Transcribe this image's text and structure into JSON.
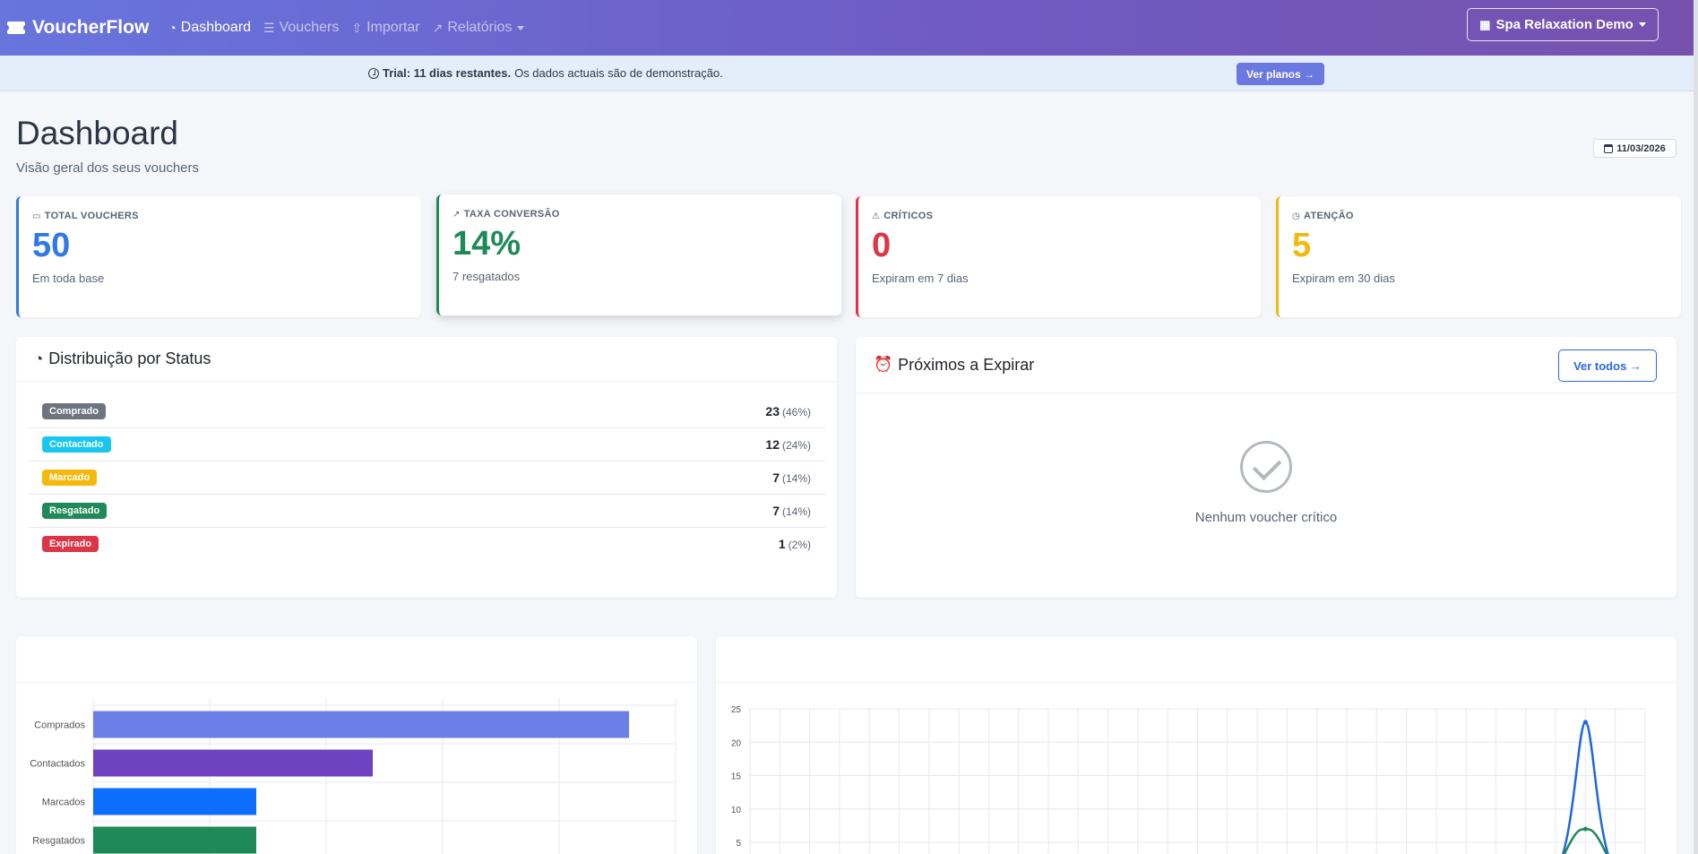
{
  "navbar": {
    "brand": "VoucherFlow",
    "items": [
      {
        "label": "Dashboard",
        "icon": "speedometer-icon",
        "active": true
      },
      {
        "label": "Vouchers",
        "icon": "list-icon",
        "active": false
      },
      {
        "label": "Importar",
        "icon": "upload-icon",
        "active": false
      },
      {
        "label": "Relatórios",
        "icon": "graph-icon",
        "active": false
      }
    ],
    "company": "Spa Relaxation Demo"
  },
  "trial": {
    "bold": "Trial: 11 dias restantes.",
    "text": "Os dados actuais são de demonstração.",
    "button": "Ver planos →"
  },
  "header": {
    "title": "Dashboard",
    "subtitle": "Visão geral dos seus vouchers",
    "date": "11/03/2026"
  },
  "stats": [
    {
      "label": "TOTAL VOUCHERS",
      "value": "50",
      "note": "Em toda base",
      "color": "#2f7ae5",
      "icon": "ticket-icon"
    },
    {
      "label": "TAXA CONVERSÃO",
      "value": "14%",
      "note": "7 resgatados",
      "color": "#1f8a57",
      "icon": "graph-up-icon"
    },
    {
      "label": "CRÍTICOS",
      "value": "0",
      "note": "Expiram em 7 dias",
      "color": "#dc3545",
      "icon": "warning-icon"
    },
    {
      "label": "ATENÇÃO",
      "value": "5",
      "note": "Expiram em 30 dias",
      "color": "#f0b912",
      "icon": "clock-icon"
    }
  ],
  "distribution": {
    "title": "Distribuição por Status",
    "rows": [
      {
        "label": "Comprado",
        "count": "23",
        "pct": "(46%)",
        "color": "#6c757d"
      },
      {
        "label": "Contactado",
        "count": "12",
        "pct": "(24%)",
        "color": "#18c6ee"
      },
      {
        "label": "Marcado",
        "count": "7",
        "pct": "(14%)",
        "color": "#f5b90d"
      },
      {
        "label": "Resgatado",
        "count": "7",
        "pct": "(14%)",
        "color": "#1f8a57"
      },
      {
        "label": "Expirado",
        "count": "1",
        "pct": "(2%)",
        "color": "#dc3545"
      }
    ]
  },
  "expiring": {
    "title": "Próximos a Expirar",
    "button": "Ver todos →",
    "empty": "Nenhum voucher crítico"
  },
  "chart_data": [
    {
      "type": "bar",
      "orientation": "horizontal",
      "categories": [
        "Comprados",
        "Contactados",
        "Marcados",
        "Resgatados"
      ],
      "values": [
        23,
        12,
        7,
        7
      ],
      "colors": [
        "#6b7ee8",
        "#6f42c1",
        "#0d6efd",
        "#1f8a57"
      ],
      "xlim": [
        0,
        25
      ],
      "grid": true
    },
    {
      "type": "line",
      "yticks": [
        "25",
        "20",
        "15",
        "10",
        "5"
      ],
      "ylim": [
        0,
        25
      ],
      "grid": true,
      "series": [
        {
          "color": "#1f66e5",
          "peak": 23
        },
        {
          "color": "#1f8a57",
          "peak": 7
        }
      ]
    }
  ]
}
